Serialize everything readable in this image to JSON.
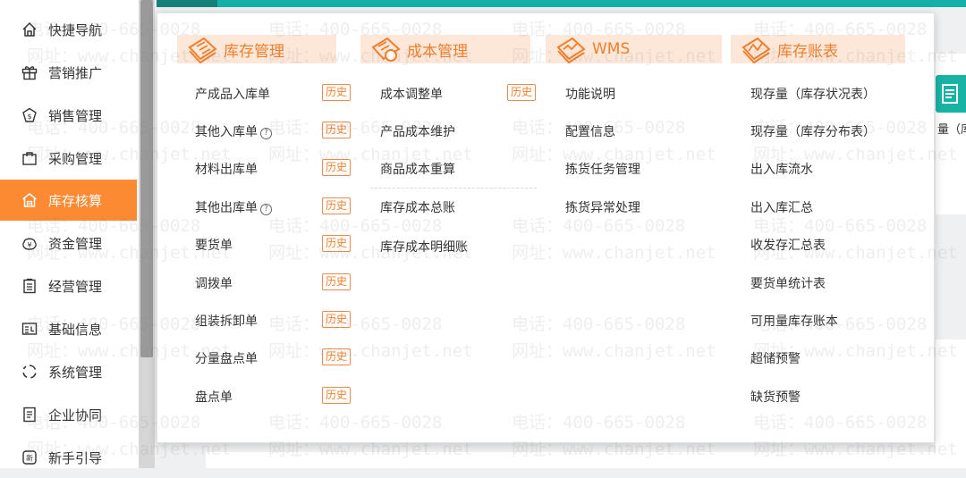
{
  "sidebar": {
    "items": [
      {
        "label": "快捷导航",
        "icon": "home-icon"
      },
      {
        "label": "营销推广",
        "icon": "gift-icon"
      },
      {
        "label": "销售管理",
        "icon": "sales-shield-icon"
      },
      {
        "label": "采购管理",
        "icon": "shopping-bag-icon"
      },
      {
        "label": "库存核算",
        "icon": "warehouse-icon",
        "active": true
      },
      {
        "label": "资金管理",
        "icon": "yen-icon"
      },
      {
        "label": "经营管理",
        "icon": "clipboard-icon"
      },
      {
        "label": "基础信息",
        "icon": "id-card-icon"
      },
      {
        "label": "系统管理",
        "icon": "loading-circle-icon"
      },
      {
        "label": "企业协同",
        "icon": "document-icon"
      },
      {
        "label": "新手引导",
        "icon": "new-badge-icon"
      }
    ]
  },
  "background": {
    "right_label": "量（库存"
  },
  "menu": {
    "columns": [
      {
        "title": "库存管理",
        "icon": "inventory-manage-icon",
        "items": [
          {
            "label": "产成品入库单",
            "history": "历史"
          },
          {
            "label": "其他入库单",
            "help": true,
            "history": "历史"
          },
          {
            "label": "材料出库单",
            "history": "历史"
          },
          {
            "label": "其他出库单",
            "help": true,
            "history": "历史"
          },
          {
            "label": "要货单",
            "history": "历史"
          },
          {
            "label": "调拨单",
            "history": "历史"
          },
          {
            "label": "组装拆卸单",
            "history": "历史"
          },
          {
            "label": "分量盘点单",
            "history": "历史"
          },
          {
            "label": "盘点单",
            "history": "历史"
          }
        ]
      },
      {
        "title": "成本管理",
        "icon": "cost-manage-icon",
        "items": [
          {
            "label": "成本调整单",
            "history": "历史"
          },
          {
            "label": "产品成本维护"
          },
          {
            "label": "商品成本重算"
          },
          {
            "label": "库存成本总账"
          },
          {
            "label": "库存成本明细账"
          }
        ]
      },
      {
        "title": "WMS",
        "icon": "wms-icon",
        "items": [
          {
            "label": "功能说明"
          },
          {
            "label": "配置信息"
          },
          {
            "label": "拣货任务管理"
          },
          {
            "label": "拣货异常处理"
          }
        ]
      },
      {
        "title": "库存账表",
        "icon": "inventory-report-icon",
        "items": [
          {
            "label": "现存量（库存状况表）"
          },
          {
            "label": "现存量（库存分布表）"
          },
          {
            "label": "出入库流水"
          },
          {
            "label": "出入库汇总"
          },
          {
            "label": "收发存汇总表"
          },
          {
            "label": "要货单统计表"
          },
          {
            "label": "可用量库存账本"
          },
          {
            "label": "超储预警"
          },
          {
            "label": "缺货预警"
          }
        ]
      }
    ]
  },
  "watermark": {
    "phone": "电话：400-665-0028",
    "site": "网址：www.chanjet.net"
  },
  "colors": {
    "accent": "#fb8a33",
    "teal": "#12b0a6",
    "menu_title": "#f07f2c",
    "history_border": "#f08a4b"
  }
}
